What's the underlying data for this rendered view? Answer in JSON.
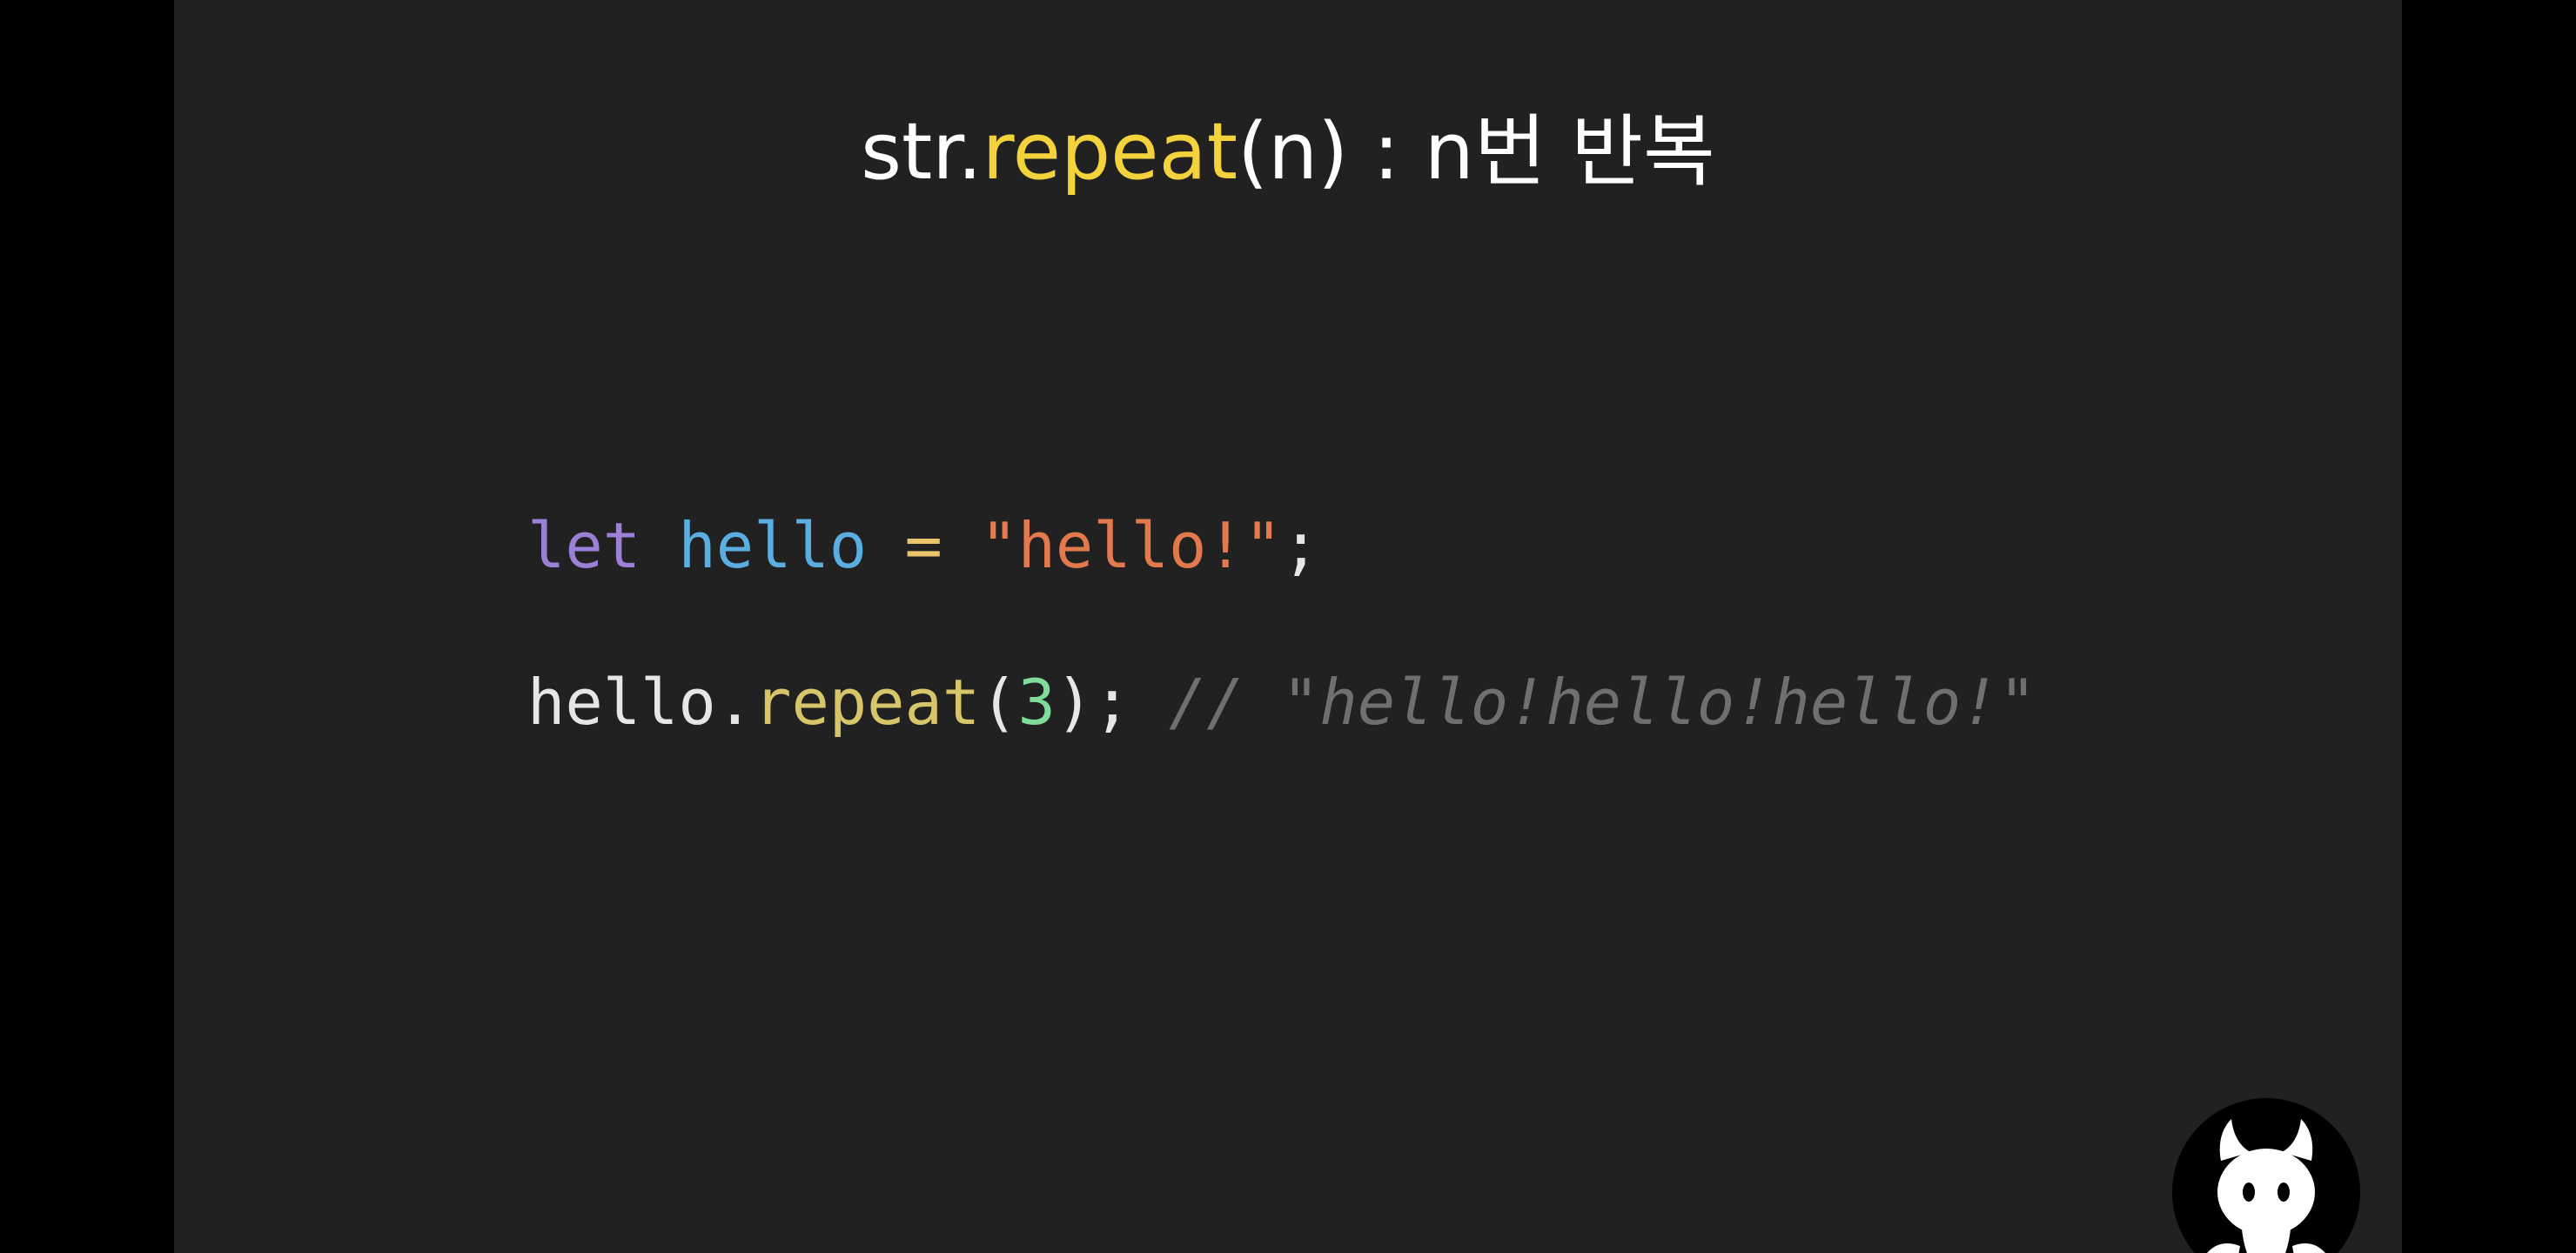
{
  "slide": {
    "title": {
      "prefix": "str.",
      "method": "repeat",
      "suffix": "(n) : n번 반복"
    },
    "code": {
      "line1": {
        "keyword": "let",
        "variable": "hello",
        "operator": "=",
        "string": "\"hello!\"",
        "terminator": ";"
      },
      "line2": {
        "object": "hello.",
        "method": "repeat",
        "open_paren": "(",
        "argument": "3",
        "close": ");",
        "comment": "// \"hello!hello!hello!\""
      }
    }
  },
  "colors": {
    "background": "#212121",
    "title_accent": "#f4d23c",
    "keyword": "#9b80d6",
    "variable": "#5aaee0",
    "string": "#e27a4e",
    "number": "#7fdc9b",
    "comment": "#6f6f6f"
  },
  "icons": {
    "avatar": "devil-cat-icon"
  }
}
